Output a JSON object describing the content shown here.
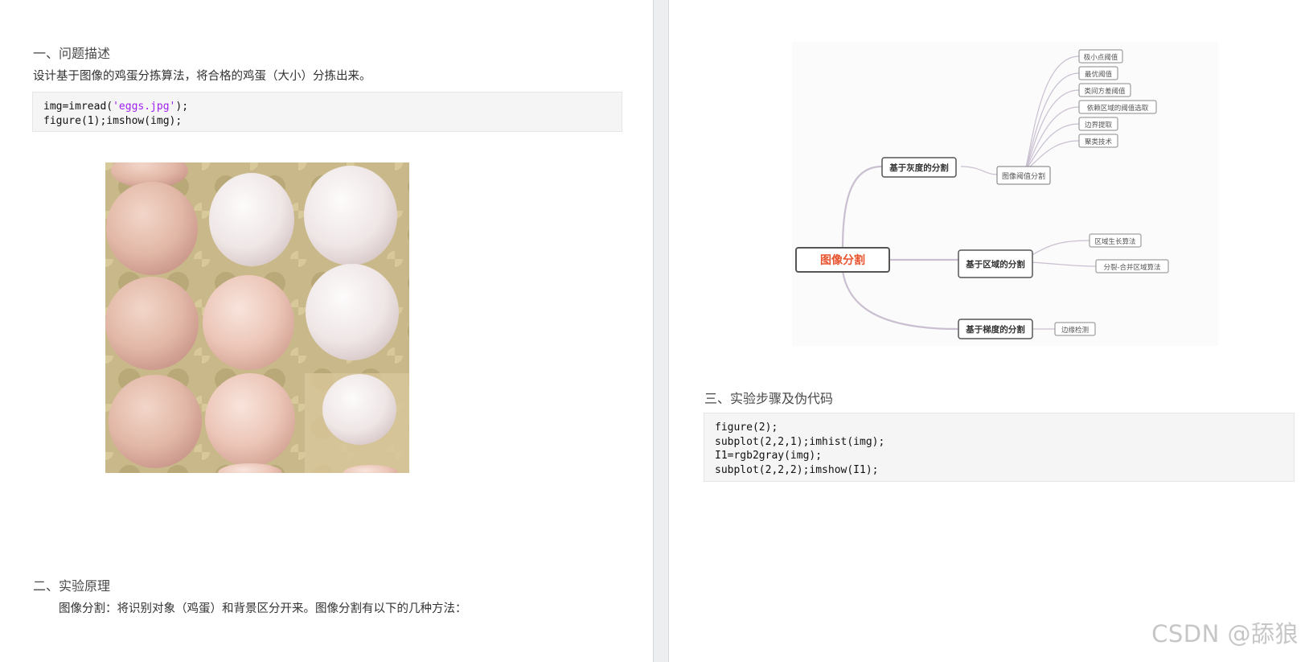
{
  "left": {
    "section1_title": "一、问题描述",
    "section1_text": "设计基于图像的鸡蛋分拣算法，将合格的鸡蛋（大小）分拣出来。",
    "code1": {
      "l1_a": "img=imread(",
      "l1_str": "'eggs.jpg'",
      "l1_b": ");",
      "l2": "figure(1);imshow(img);"
    },
    "section2_title": "二、实验原理",
    "section2_text": "图像分割：将识别对象（鸡蛋）和背景区分开来。图像分割有以下的几种方法："
  },
  "mindmap": {
    "root": "图像分割",
    "branch_gray": "基于灰度的分割",
    "branch_region": "基于区域的分割",
    "branch_gradient": "基于梯度的分割",
    "threshold": "图像阈值分割",
    "leaf_min_point": "极小点阈值",
    "leaf_optimal": "最优阈值",
    "leaf_variance": "类间方差阈值",
    "leaf_region_threshold": "依赖区域的阈值选取",
    "leaf_edge_extract": "边界提取",
    "leaf_cluster": "聚类技术",
    "leaf_region_grow": "区域生长算法",
    "leaf_split_merge": "分裂-合并区域算法",
    "leaf_edge_detect": "边缘检测",
    "colors": {
      "root_text": "#e8542f",
      "line": "#c9bfd1",
      "node_border": "#555555"
    }
  },
  "right": {
    "section3_title": "三、实验步骤及伪代码",
    "code2": [
      "figure(2);",
      "subplot(2,2,1);imhist(img);",
      "I1=rgb2gray(img);",
      "subplot(2,2,2);imshow(I1);"
    ]
  },
  "watermark": "CSDN @舔狼"
}
